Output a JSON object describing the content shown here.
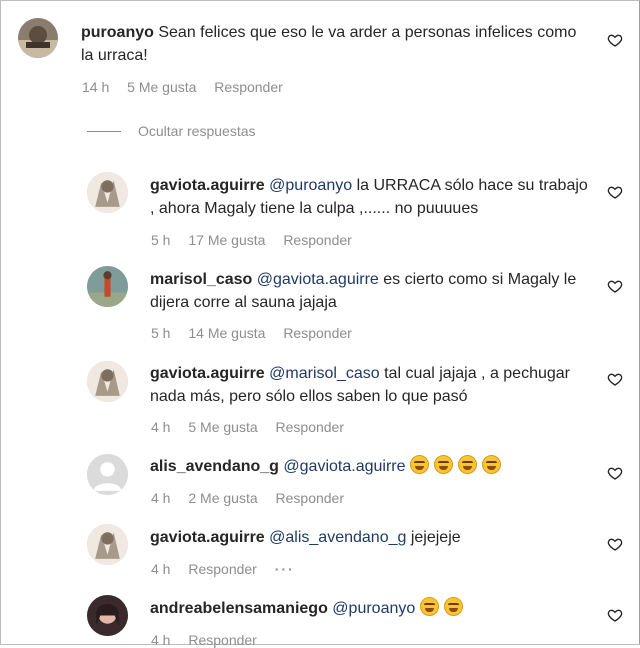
{
  "comments": [
    {
      "user": "puroanyo",
      "text": "Sean felices que eso le va arder a personas infelices como la urraca!",
      "time": "14 h",
      "likes": "5 Me gusta",
      "reply": "Responder"
    }
  ],
  "hide_replies_label": "Ocultar respuestas",
  "replies": [
    {
      "user": "gaviota.aguirre",
      "mention": "@puroanyo",
      "text": " la URRACA sólo hace su trabajo , ahora Magaly tiene la culpa ,...... no puuuues",
      "time": "5 h",
      "likes": "17 Me gusta",
      "reply": "Responder"
    },
    {
      "user": "marisol_caso",
      "mention": "@gaviota.aguirre",
      "text": " es cierto como si Magaly le dijera corre al sauna jajaja",
      "time": "5 h",
      "likes": "14 Me gusta",
      "reply": "Responder"
    },
    {
      "user": "gaviota.aguirre",
      "mention": "@marisol_caso",
      "text": " tal cual jajaja , a pechugar nada más, pero sólo ellos saben lo que pasó",
      "time": "4 h",
      "likes": "5 Me gusta",
      "reply": "Responder"
    },
    {
      "user": "alis_avendano_g",
      "mention": "@gaviota.aguirre",
      "text": "",
      "emoji_count": 4,
      "emoji_name": "rolling-on-floor-laughing-emoji",
      "time": "4 h",
      "likes": "2 Me gusta",
      "reply": "Responder"
    },
    {
      "user": "gaviota.aguirre",
      "mention": "@alis_avendano_g",
      "text": " jejejeje",
      "time": "4 h",
      "reply": "Responder",
      "more": "···"
    },
    {
      "user": "andreabelensamaniego",
      "mention": "@puroanyo",
      "text": "",
      "emoji_count": 2,
      "emoji_name": "face-with-tears-of-joy-emoji",
      "time": "4 h",
      "reply": "Responder"
    }
  ],
  "icons": {
    "like": "heart-outline-icon",
    "more": "more-options-icon"
  },
  "colors": {
    "text": "#262626",
    "meta": "#8e8e8e",
    "mention": "#1f3a63"
  }
}
